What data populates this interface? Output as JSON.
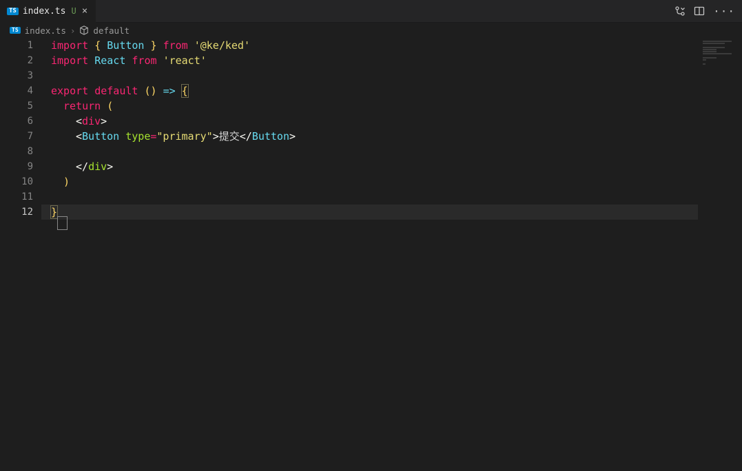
{
  "tab": {
    "filename": "index.ts",
    "badge": "TS",
    "status": "U",
    "close_glyph": "×"
  },
  "crumbs": {
    "file_badge": "TS",
    "file": "index.ts",
    "sep": "›",
    "symbol": "default"
  },
  "actions": {
    "ellipsis": "···"
  },
  "editor": {
    "line_numbers": [
      "1",
      "2",
      "3",
      "4",
      "5",
      "6",
      "7",
      "8",
      "9",
      "10",
      "11",
      "12"
    ],
    "active_line_index": 11,
    "tokens": {
      "l1": {
        "import": "import",
        "ob": "{",
        "Button": "Button",
        "cb": "}",
        "from": "from",
        "pkg": "'@ke/ked'"
      },
      "l2": {
        "import": "import",
        "React": "React",
        "from": "from",
        "pkg": "'react'"
      },
      "l4": {
        "export": "export",
        "default": "default",
        "op1": "(",
        "op2": ")",
        "arrow": "=>",
        "ob": "{"
      },
      "l5": {
        "return": "return",
        "op": "("
      },
      "l6": {
        "lt": "<",
        "div": "div",
        "gt": ">"
      },
      "l7": {
        "lt": "<",
        "Button": "Button",
        "attr": "type",
        "eq": "=",
        "val": "\"primary\"",
        "gt1": ">",
        "text": "提交",
        "lte": "</",
        "ButtonC": "Button",
        "gt2": ">"
      },
      "l9": {
        "lte": "</",
        "div": "div",
        "gt": ">"
      },
      "l10": {
        "cp": ")"
      },
      "l12": {
        "cb": "}"
      }
    }
  }
}
